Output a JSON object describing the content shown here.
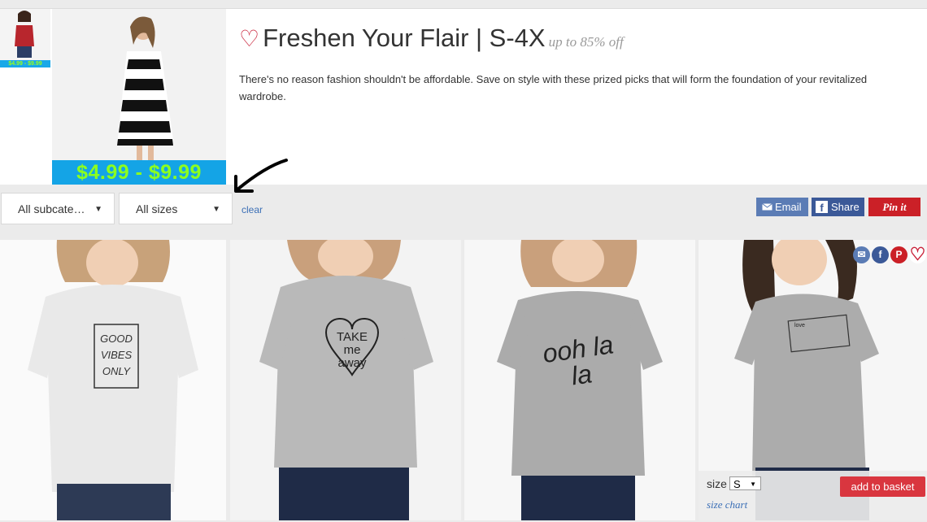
{
  "promo": {
    "title": "Freshen Your Flair | S-4X",
    "title_suffix": "up to 85% off",
    "description": "There's no reason fashion shouldn't be affordable. Save on style with these prized picks that will form the foundation of your revitalized wardrobe.",
    "thumb_price": "$4.99 - $9.99",
    "hero_price": "$4.99 - $9.99"
  },
  "filters": {
    "subcategory": "All subcate…",
    "sizes": "All sizes",
    "clear": "clear"
  },
  "share": {
    "email": "Email",
    "facebook": "Share",
    "pinterest": "Pin it"
  },
  "products": [
    {
      "shirt_text": "GOOD VIBES ONLY"
    },
    {
      "shirt_text": "TAKE me away"
    },
    {
      "shirt_text": "ooh la la"
    },
    {
      "shirt_text": "love"
    }
  ],
  "basket": {
    "size_label": "size",
    "size_value": "S",
    "size_chart": "size chart",
    "add_button": "add to basket"
  },
  "colors": {
    "accent_red": "#d9363f",
    "link_blue": "#3b6fb6",
    "price_band": "#14a4e6",
    "price_text": "#8cff1f"
  }
}
